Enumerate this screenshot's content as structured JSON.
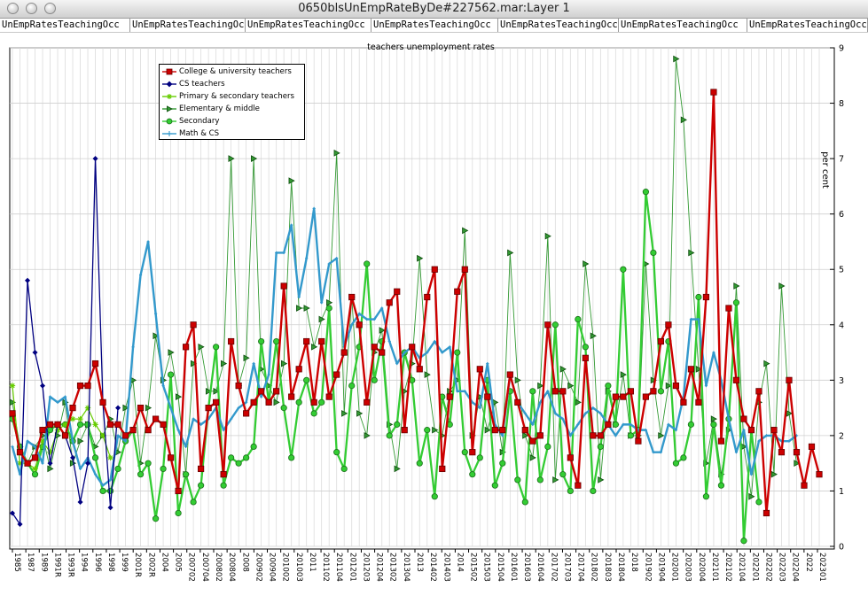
{
  "window": {
    "title": "0650blsUnEmpRateByDe#227562.mar:Layer 1"
  },
  "tabs": [
    "UnEmpRatesTeachingOcc",
    "UnEmpRatesTeachingOcc",
    "UnEmpRatesTeachingOcc",
    "UnEmpRatesTeachingOcc",
    "UnEmpRatesTeachingOcc",
    "UnEmpRatesTeachingOcc",
    "UnEmpRatesTeachingOcc"
  ],
  "chart_data": {
    "type": "line",
    "title": "teachers unemployment rates",
    "ylabel": "per cent",
    "ylim": [
      0,
      9
    ],
    "ytick_labels": [
      "0",
      "1",
      "2",
      "3",
      "4",
      "5",
      "6",
      "7",
      "8",
      "9"
    ],
    "y_axis_side": "right",
    "grid": true,
    "legend_placement": "top-left",
    "x_tick_labels": [
      "1985",
      "1987",
      "1989",
      "1991R",
      "1993R",
      "1994",
      "1996",
      "1998",
      "1999",
      "2001R",
      "2002R",
      "2004",
      "2005",
      "200702",
      "200704",
      "200802",
      "200804",
      "2008",
      "200902",
      "200904",
      "201002",
      "201003",
      "2011",
      "201102",
      "201104",
      "201201",
      "201203",
      "201204",
      "201302",
      "201304",
      "2013",
      "201402",
      "201403",
      "2014",
      "201502",
      "201503",
      "201504",
      "201601",
      "201603",
      "201604",
      "201702",
      "201703",
      "201704",
      "201802",
      "201803",
      "201804",
      "2018",
      "201902",
      "201904",
      "202001",
      "202003",
      "202004",
      "202101",
      "202102",
      "202104",
      "202201",
      "202202",
      "202203",
      "202204",
      "2022",
      "202301"
    ],
    "series": [
      {
        "name": "College & university teachers",
        "color": "#cc0000",
        "marker": "square",
        "values": [
          2.4,
          1.7,
          1.5,
          1.6,
          2.1,
          2.2,
          2.2,
          2.0,
          2.5,
          2.9,
          2.9,
          3.3,
          2.6,
          2.2,
          2.2,
          2.0,
          2.1,
          2.5,
          2.1,
          2.3,
          2.2,
          1.6,
          1.0,
          3.6,
          4.0,
          1.4,
          2.5,
          2.6,
          1.3,
          3.7,
          2.9,
          2.4,
          2.6,
          2.8,
          2.6,
          2.8,
          4.7,
          2.7,
          3.2,
          3.7,
          2.6,
          3.7,
          2.7,
          3.1,
          3.5,
          4.5,
          4.0,
          2.6,
          3.6,
          3.5,
          4.4,
          4.6,
          2.1,
          3.6,
          3.2,
          4.5,
          5.0,
          1.4,
          2.7,
          4.6,
          5.0,
          1.7,
          3.2,
          2.7,
          2.1,
          2.1,
          3.1,
          2.6,
          2.1,
          1.9,
          2.0,
          4.0,
          2.8,
          2.8,
          1.6,
          1.1,
          3.4,
          2.0,
          2.0,
          2.2,
          2.7,
          2.7,
          2.8,
          1.9,
          2.7,
          2.8,
          3.7,
          4.0,
          2.9,
          2.6,
          3.2,
          2.6,
          4.5,
          8.2,
          1.9,
          4.3,
          3.0,
          2.3,
          2.1,
          2.8,
          0.6,
          2.1,
          1.7,
          3.0,
          1.7,
          1.1,
          1.8,
          1.3
        ]
      },
      {
        "name": "CS teachers",
        "color": "#000080",
        "marker": "diamond",
        "values": [
          0.6,
          0.4,
          4.8,
          3.5,
          2.9,
          1.5,
          2.2,
          2.0,
          1.6,
          0.8,
          1.5,
          7.0,
          2.6,
          0.7,
          2.5
        ]
      },
      {
        "name": "Primary & secondary teachers",
        "color": "#66cc00",
        "marker": "asterisk",
        "values": [
          2.9,
          1.5,
          1.5,
          1.4,
          1.9,
          1.7,
          2.1,
          2.2,
          2.3,
          2.3,
          2.5,
          2.2,
          2.0,
          1.6
        ]
      },
      {
        "name": "Elementary & middle",
        "color": "#339933",
        "marker": "triangle",
        "values": [
          2.6,
          1.8,
          1.5,
          1.8,
          2.0,
          1.4,
          2.0,
          2.6,
          1.5,
          1.9,
          2.2,
          1.8,
          2.0,
          2.3,
          1.7,
          2.5,
          3.0,
          1.5,
          2.5,
          3.8,
          3.0,
          3.5,
          2.7,
          1.3,
          3.3,
          3.6,
          2.8,
          2.8,
          3.3,
          7.0,
          2.9,
          3.4,
          7.0,
          3.2,
          2.9,
          2.6,
          3.3,
          6.6,
          4.3,
          4.3,
          3.6,
          4.1,
          4.4,
          7.1,
          2.4,
          4.5,
          2.4,
          2.0,
          3.5,
          3.9,
          2.2,
          1.4,
          2.8,
          3.3,
          5.2,
          3.1,
          2.1,
          2.0,
          2.8,
          3.0,
          5.7,
          2.0,
          2.7,
          2.1,
          2.6,
          1.7,
          5.3,
          3.0,
          2.0,
          1.6,
          2.9,
          5.6,
          1.2,
          3.2,
          2.9,
          2.6,
          5.1,
          3.8,
          1.2,
          2.8,
          2.2,
          3.1,
          2.0,
          2.0,
          5.1,
          3.0,
          2.0,
          2.9,
          8.8,
          7.7,
          5.3,
          3.2,
          1.5,
          2.3,
          1.3,
          2.1,
          4.7,
          1.8,
          0.9,
          2.6,
          3.3,
          1.3,
          4.7,
          2.4,
          1.5
        ]
      },
      {
        "name": "Secondary",
        "color": "#33cc33",
        "marker": "circle",
        "values": [
          2.3,
          1.8,
          1.5,
          1.3,
          1.8,
          2.1,
          2.2,
          2.2,
          1.9,
          2.2,
          2.2,
          1.6,
          1.0,
          1.0,
          1.4,
          1.9,
          2.1,
          1.3,
          1.5,
          0.5,
          1.4,
          3.1,
          0.6,
          1.3,
          0.8,
          1.1,
          2.5,
          3.6,
          1.1,
          1.6,
          1.5,
          1.6,
          1.8,
          3.7,
          2.6,
          3.7,
          2.5,
          1.6,
          2.6,
          3.0,
          2.4,
          2.6,
          4.3,
          1.7,
          1.4,
          2.9,
          3.6,
          5.1,
          3.0,
          3.7,
          2.0,
          2.2,
          3.5,
          3.0,
          1.5,
          2.1,
          0.9,
          2.7,
          2.2,
          3.5,
          1.7,
          1.3,
          1.6,
          3.0,
          1.1,
          1.5,
          2.8,
          1.2,
          0.8,
          2.8,
          1.2,
          1.8,
          4.0,
          1.3,
          1.0,
          4.1,
          3.6,
          1.0,
          1.8,
          2.9,
          2.2,
          5.0,
          2.0,
          2.1,
          6.4,
          5.3,
          2.8,
          3.7,
          1.5,
          1.6,
          2.2,
          4.5,
          0.9,
          2.2,
          1.1,
          2.3,
          4.4,
          0.1,
          2.1,
          0.8
        ]
      },
      {
        "name": "Math & CS",
        "color": "#3399cc",
        "marker": "plus",
        "values": [
          1.8,
          1.3,
          1.9,
          1.8,
          1.5,
          2.7,
          2.6,
          2.7,
          1.9,
          1.4,
          1.6,
          1.3,
          1.1,
          1.2,
          2.0,
          1.9,
          3.6,
          4.9,
          5.5,
          4.2,
          2.9,
          2.5,
          2.1,
          1.8,
          2.3,
          2.2,
          2.3,
          2.5,
          2.1,
          2.3,
          2.5,
          2.6,
          3.3,
          2.7,
          3.1,
          5.3,
          5.3,
          5.8,
          4.5,
          5.2,
          6.1,
          4.4,
          5.1,
          5.2,
          3.6,
          4.0,
          4.2,
          4.1,
          4.1,
          4.3,
          3.7,
          3.3,
          3.5,
          3.6,
          3.4,
          3.5,
          3.7,
          3.5,
          3.6,
          2.8,
          2.8,
          2.6,
          2.5,
          3.3,
          2.2,
          2.0,
          3.1,
          2.6,
          2.4,
          2.2,
          2.6,
          2.8,
          2.4,
          2.3,
          2.0,
          2.2,
          2.4,
          2.5,
          2.4,
          2.2,
          2.0,
          2.2,
          2.2,
          2.1,
          2.1,
          1.7,
          1.7,
          2.2,
          2.1,
          2.7,
          4.1,
          4.1,
          2.9,
          3.5,
          3.0,
          2.3,
          1.7,
          2.1,
          1.3,
          1.9,
          2.0,
          2.0,
          1.9,
          1.9,
          2.0
        ]
      }
    ]
  }
}
